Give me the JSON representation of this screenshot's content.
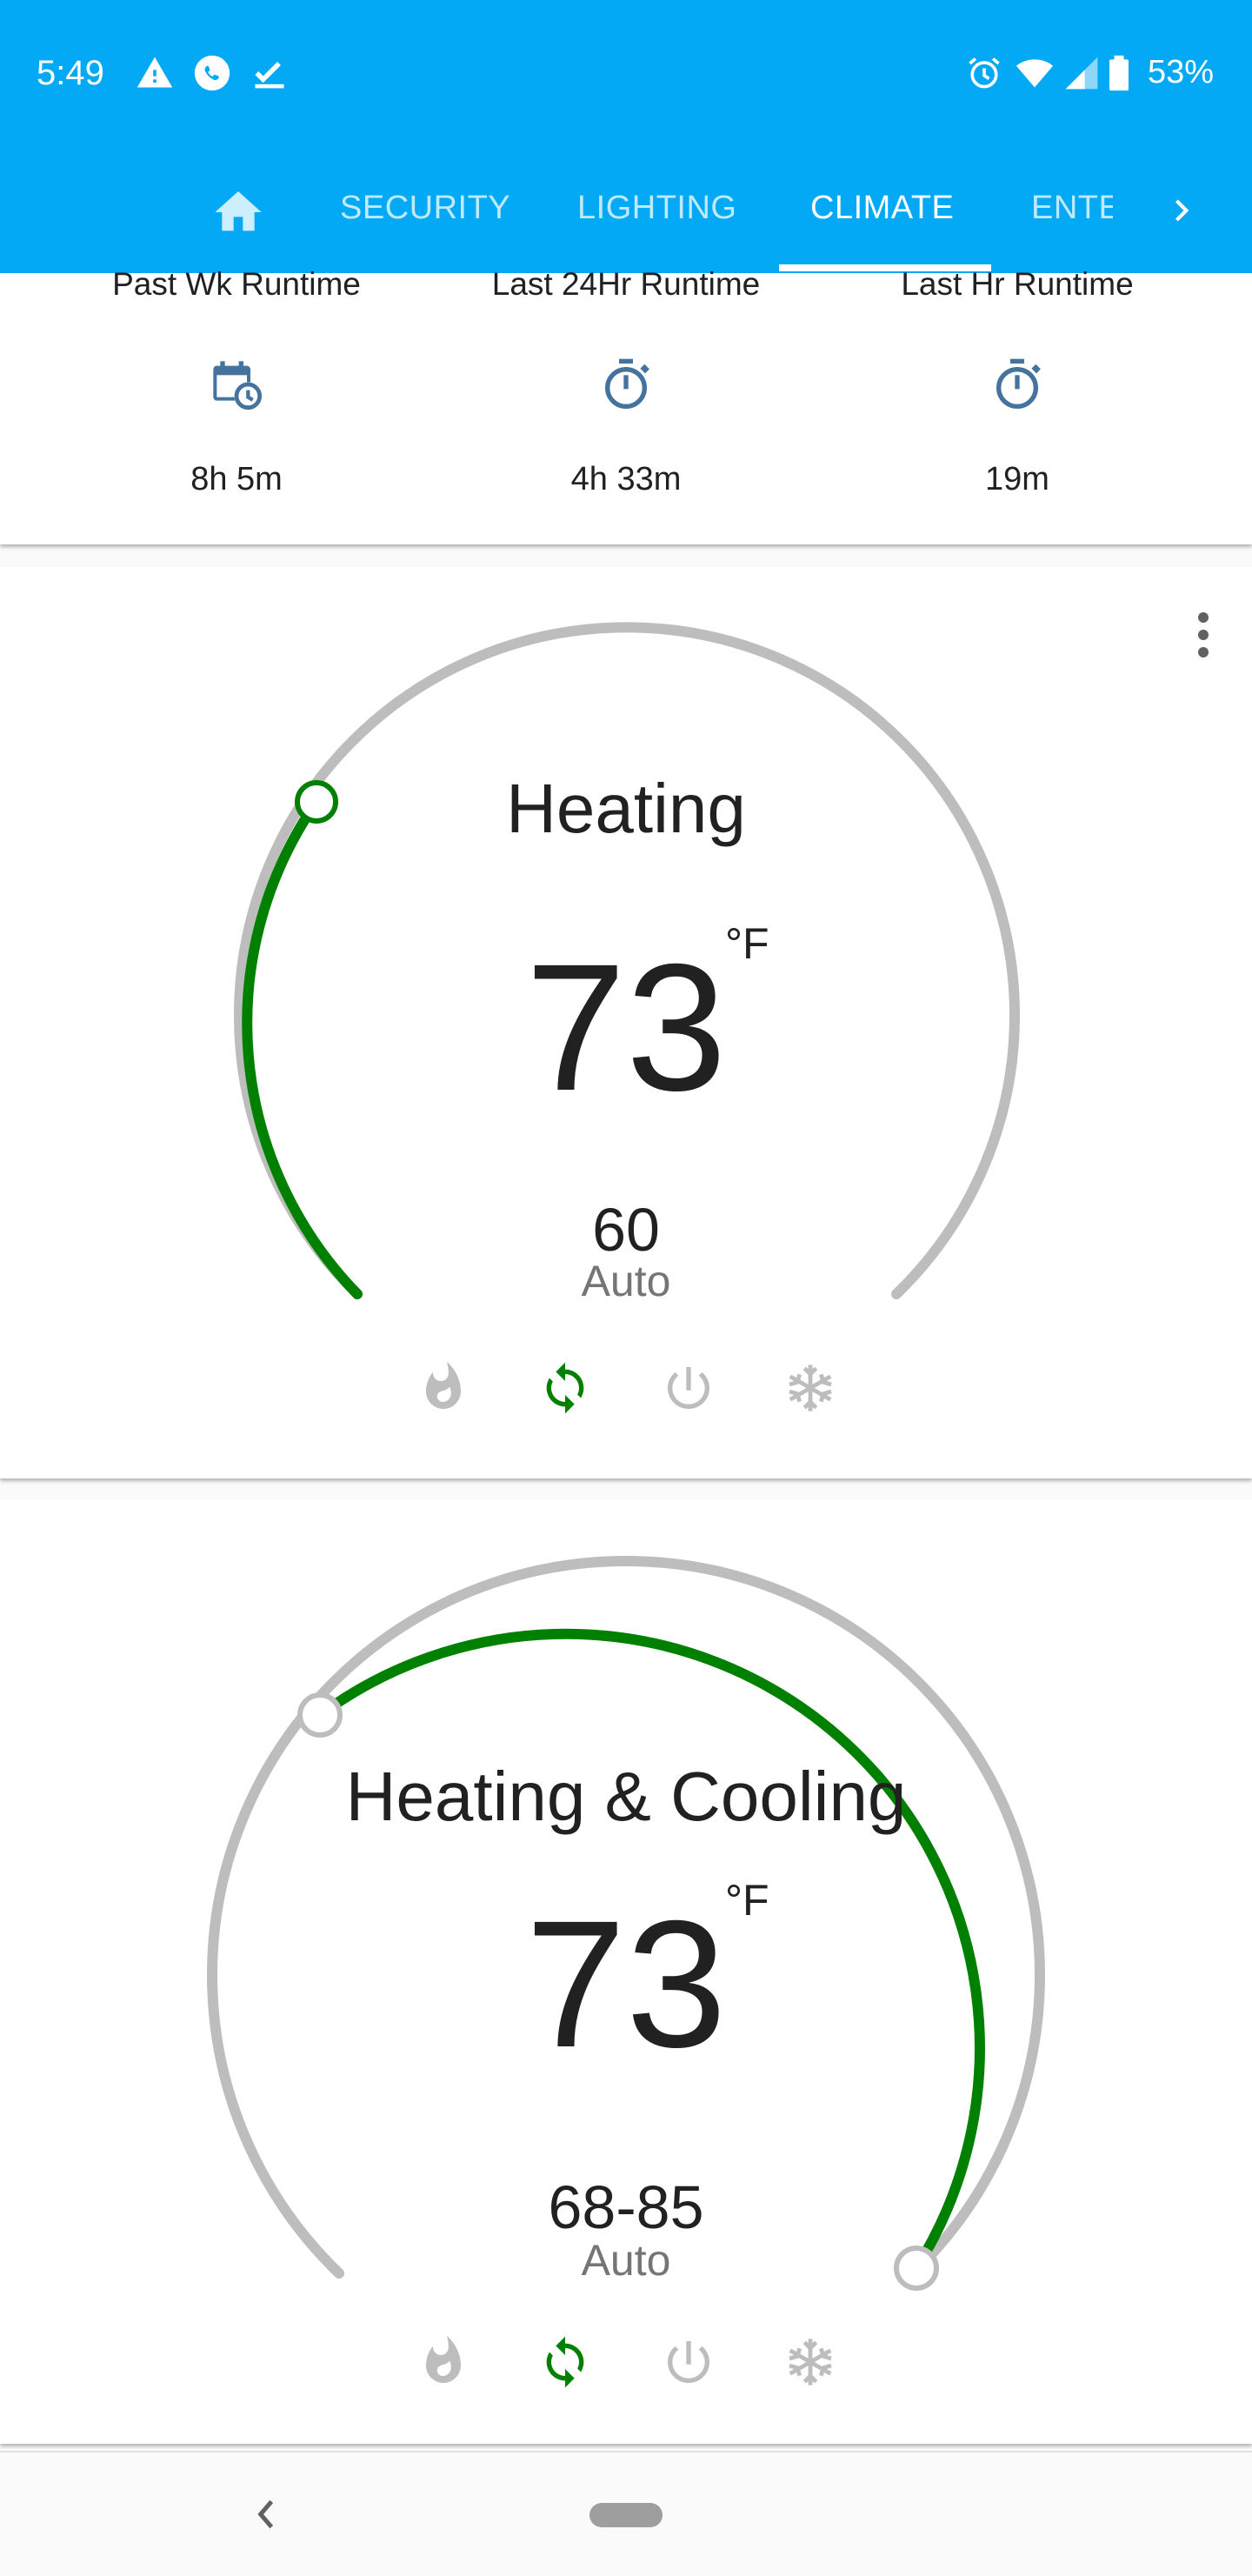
{
  "status_bar": {
    "time": "5:49",
    "battery": "53%",
    "left_icons": [
      "warning-icon",
      "phone-call-icon",
      "checkbox-icon"
    ],
    "right_icons": [
      "alarm-icon",
      "wifi-icon",
      "cell-signal-icon",
      "battery-icon"
    ]
  },
  "tabs": {
    "home_icon": "home-icon",
    "items": [
      {
        "label": "SECURITY",
        "active": false
      },
      {
        "label": "LIGHTING",
        "active": false
      },
      {
        "label": "CLIMATE",
        "active": true
      },
      {
        "label": "ENTE",
        "active": false
      }
    ],
    "scroll_icon": "chevron-right-icon"
  },
  "colors": {
    "primary": "#03a9f4",
    "active_arc": "#008000",
    "inactive_arc": "#bdbdbd",
    "icon_blue": "#44739e"
  },
  "runtime": {
    "items": [
      {
        "label": "Past Wk Runtime",
        "value": "8h 5m",
        "icon": "calendar-clock-icon"
      },
      {
        "label": "Last 24Hr Runtime",
        "value": "4h 33m",
        "icon": "timer-icon"
      },
      {
        "label": "Last Hr Runtime",
        "value": "19m",
        "icon": "timer-icon"
      }
    ]
  },
  "thermostats": [
    {
      "name": "Heating",
      "temperature": "73",
      "unit": "°F",
      "setpoint": "60",
      "mode": "Auto",
      "active_mode": "auto",
      "modes": [
        "heat",
        "auto",
        "off",
        "cool"
      ]
    },
    {
      "name": "Heating & Cooling",
      "temperature": "73",
      "unit": "°F",
      "setpoint": "68-85",
      "mode": "Auto",
      "active_mode": "auto",
      "modes": [
        "heat",
        "auto",
        "off",
        "cool"
      ]
    }
  ],
  "nav_bar": {
    "back_icon": "back-chevron-icon",
    "home_icon": "home-pill-icon"
  }
}
